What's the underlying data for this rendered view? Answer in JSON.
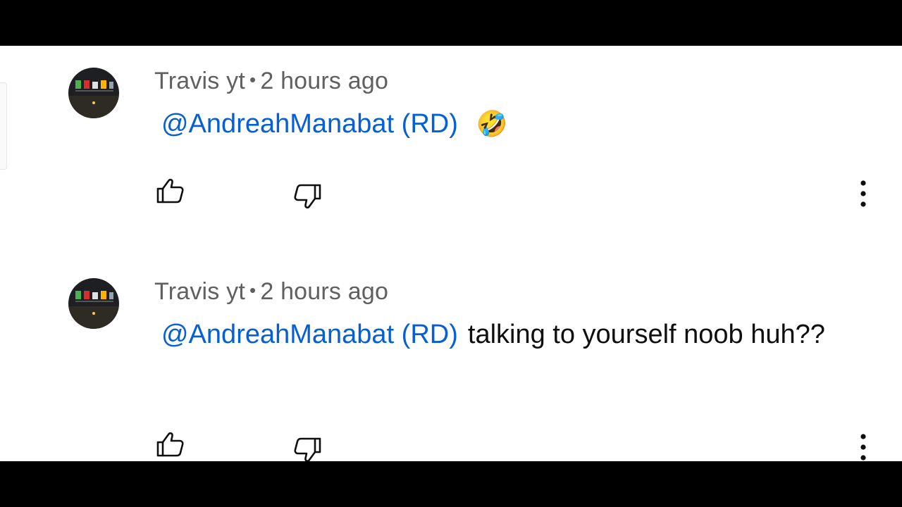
{
  "comments": [
    {
      "author": "Travis yt",
      "separator": "•",
      "time": "2 hours ago",
      "mention": "@AndreahManabat (RD)",
      "text": "",
      "emoji": "🤣"
    },
    {
      "author": "Travis yt",
      "separator": "•",
      "time": "2 hours ago",
      "mention": "@AndreahManabat (RD)",
      "text": "talking to yourself noob huh??",
      "emoji": ""
    }
  ],
  "icons": {
    "like": "thumbs-up-icon",
    "dislike": "thumbs-down-icon",
    "more": "more-vert-icon"
  },
  "colors": {
    "mention": "#065fd4",
    "meta": "#606060",
    "text": "#0f0f0f",
    "background": "#ffffff",
    "letterbox": "#000000"
  }
}
